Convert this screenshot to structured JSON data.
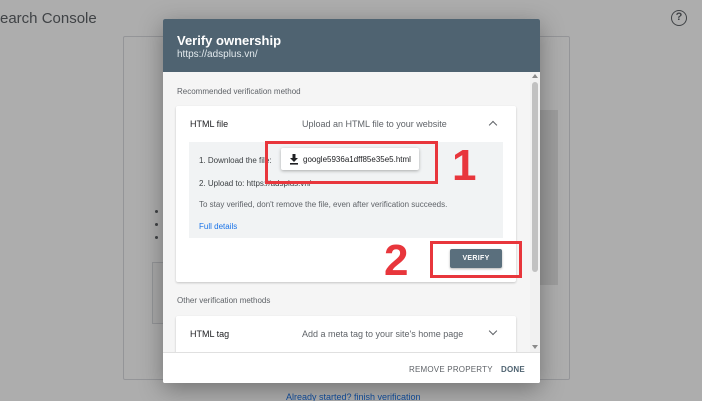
{
  "background": {
    "app_title": "earch Console",
    "help_icon": "help-circle-icon",
    "footer_link": "Already started? finish verification"
  },
  "dialog": {
    "title": "Verify ownership",
    "subtitle": "https://adsplus.vn/",
    "recommended_label": "Recommended verification method",
    "html_file": {
      "name": "HTML file",
      "description": "Upload an HTML file to your website",
      "step1_label": "1. Download the file:",
      "download_icon": "download-icon",
      "download_filename": "google5936a1dff85e35e5.html",
      "step2_label": "2. Upload to: https://adsplus.vn/",
      "stay_verified_text": "To stay verified, don't remove the file, even after verification succeeds.",
      "full_details_link": "Full details",
      "verify_label": "VERIFY"
    },
    "other_label": "Other verification methods",
    "html_tag": {
      "name": "HTML tag",
      "description": "Add a meta tag to your site's home page"
    },
    "footer": {
      "remove_label": "REMOVE PROPERTY",
      "done_label": "DONE"
    }
  },
  "annotations": {
    "step_one": "1",
    "step_two": "2",
    "color": "#e8363c"
  },
  "colors": {
    "header_bg": "#4f6371",
    "verify_bg": "#5a6f7d",
    "link": "#1a73e8"
  }
}
